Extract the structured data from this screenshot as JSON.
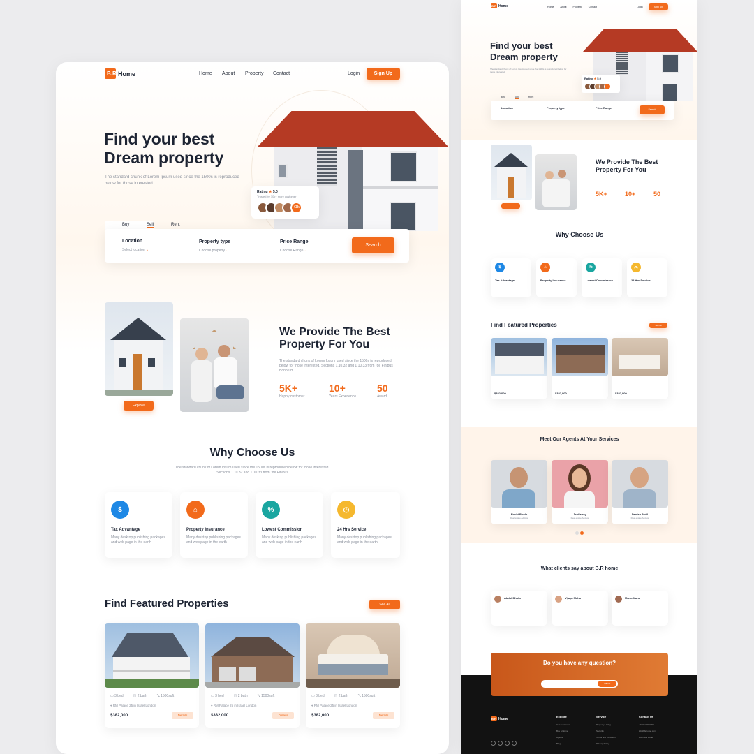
{
  "brand": {
    "logo_mark": "B.R",
    "logo_text": "Home",
    "accent": "#f26a1b"
  },
  "nav": {
    "home": "Home",
    "about": "About",
    "property": "Property",
    "contact": "Contact",
    "login": "Login",
    "signup": "Sign Up"
  },
  "hero": {
    "title_line1": "Find your best",
    "title_line2": "Dream property",
    "subtitle": "The standard chunk of Lorem Ipsum used since the 1500s is reproduced below for those interested.",
    "rating_label": "Rating",
    "rating_value": "5.0",
    "rating_sub": "Trusted by 10k+ more customer",
    "avatar_count": "+3k"
  },
  "search": {
    "tabs": [
      "Buy",
      "Sell",
      "Rent"
    ],
    "location_label": "Location",
    "location_value": "Select location",
    "type_label": "Property type",
    "type_value": "Choose property",
    "price_label": "Price Range",
    "price_value": "Choose Range",
    "button": "Search"
  },
  "provide": {
    "title_line1": "We Provide The Best",
    "title_line2": "Property For You",
    "text": "The standard chunk of Lorem Ipsum used since the 1500s is reproduced below for those interested. Sections 1.10.32 and 1.10.33 from \"de Finibus Bonorum",
    "button": "Explore",
    "stats": [
      {
        "value": "5K+",
        "label": "Happy customer"
      },
      {
        "value": "10+",
        "label": "Years Experience"
      },
      {
        "value": "50",
        "label": "Award"
      }
    ]
  },
  "why": {
    "title": "Why Choose Us",
    "subtitle": "The standard chunk of Lorem Ipsum used since the 1500s is reproduced below for those interested. Sections 1.10.32 and 1.10.33 from \"de Finibus",
    "items": [
      {
        "title": "Tax Advantage",
        "text": "Many desktop publishing packages and web page in the earth",
        "color": "#1e88e5",
        "icon": "tax-icon"
      },
      {
        "title": "Property Insurance",
        "text": "Many desktop publishing packages and web page in the earth",
        "color": "#f26a1b",
        "icon": "insurance-icon"
      },
      {
        "title": "Lowest Commission",
        "text": "Many desktop publishing packages and web page in the earth",
        "color": "#1aa6a0",
        "icon": "commission-icon"
      },
      {
        "title": "24 Hrs Service",
        "text": "Many desktop publishing packages and web page in the earth",
        "color": "#f5b82e",
        "icon": "clock-icon"
      }
    ]
  },
  "featured": {
    "title": "Find Featured Properties",
    "see_all": "See All",
    "cards": [
      {
        "beds": "3 bed",
        "baths": "2 bath",
        "area": "1500sqft",
        "address": "RM Palace 25 in Israel London",
        "price": "$382,000",
        "details": "Details"
      },
      {
        "beds": "3 bed",
        "baths": "2 bath",
        "area": "1500sqft",
        "address": "RM Palace 25 in Israel London",
        "price": "$382,000",
        "details": "Details"
      },
      {
        "beds": "3 bed",
        "baths": "2 bath",
        "area": "1500sqft",
        "address": "RM Palace 25 in Israel London",
        "price": "$382,000",
        "details": "Details"
      }
    ]
  },
  "mobile": {
    "nav": [
      "Home",
      "About",
      "Property",
      "Contact"
    ],
    "login": "Login",
    "signup": "Sign Up",
    "search_button": "Search",
    "search_tabs": [
      "Buy",
      "Sell",
      "Rent"
    ],
    "agents_title": "Meet Our Agents At Your Services",
    "agents": [
      {
        "name": "Ruchi Bhole",
        "role": "Real estate Advisor"
      },
      {
        "name": "Jenifa ray",
        "role": "Real estate Advisor"
      },
      {
        "name": "Danish Antil",
        "role": "Real estate Advisor"
      }
    ],
    "clients_title": "What clients say about B.R home",
    "clients": [
      {
        "name": "Abdul Bholu",
        "role": "Customer"
      },
      {
        "name": "Vijaya Mehu",
        "role": "Customer"
      },
      {
        "name": "Maria Mara",
        "role": "Customer"
      }
    ],
    "question_title": "Do you have any question?",
    "question_button": "Submit",
    "footer": {
      "explore": "Explore",
      "explore_items": [
        "Get Customers",
        "Buy a Home",
        "Agents",
        "Blog"
      ],
      "service": "Service",
      "service_items": [
        "Property Listing",
        "Security",
        "Terms and Condition",
        "Privacy Policy"
      ],
      "contact": "Contact Us",
      "contact_items": [
        "+1800 000 0000",
        "info@brhome.com",
        "Business Road"
      ]
    }
  }
}
